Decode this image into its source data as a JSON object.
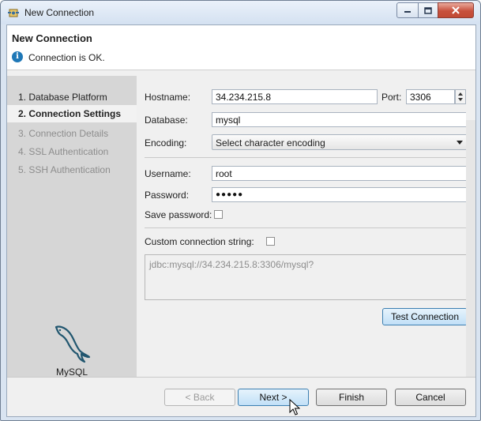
{
  "window": {
    "title": "New Connection"
  },
  "header": {
    "title": "New Connection",
    "message": "Connection is OK."
  },
  "steps": [
    {
      "label": "1. Database Platform",
      "state": "done"
    },
    {
      "label": "2. Connection Settings",
      "state": "current"
    },
    {
      "label": "3. Connection Details",
      "state": "disabled"
    },
    {
      "label": "4. SSL Authentication",
      "state": "disabled"
    },
    {
      "label": "5. SSH Authentication",
      "state": "disabled"
    }
  ],
  "platform": {
    "label": "MySQL",
    "icon": "mysql-dolphin-icon"
  },
  "form": {
    "hostname_label": "Hostname:",
    "hostname_value": "34.234.215.8",
    "port_label": "Port:",
    "port_value": "3306",
    "database_label": "Database:",
    "database_value": "mysql",
    "encoding_label": "Encoding:",
    "encoding_value": "Select character encoding",
    "username_label": "Username:",
    "username_value": "root",
    "password_label": "Password:",
    "password_mask": "●●●●●",
    "save_password_label": "Save password:",
    "custom_conn_label": "Custom connection string:",
    "jdbc_string": "jdbc:mysql://34.234.215.8:3306/mysql?",
    "test_button": "Test Connection"
  },
  "footer": {
    "back": "< Back",
    "next": "Next >",
    "finish": "Finish",
    "cancel": "Cancel"
  },
  "colors": {
    "accent": "#1f78b7",
    "sidebar": "#d6d6d6",
    "close": "#c8513d"
  }
}
